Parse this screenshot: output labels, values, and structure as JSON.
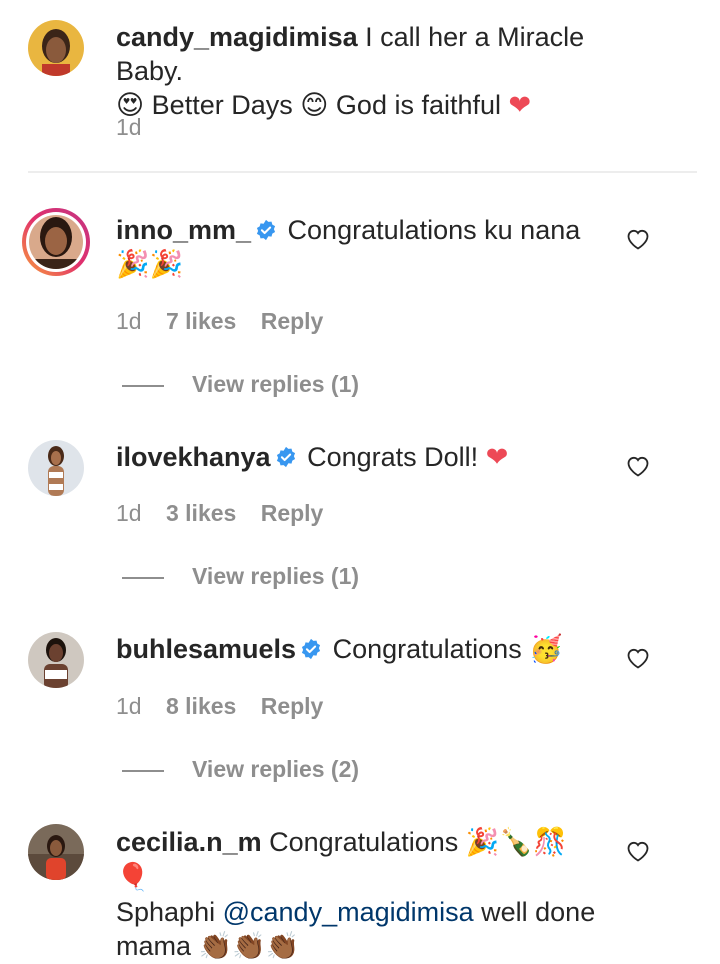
{
  "comments": [
    {
      "username": "candy_magidimisa",
      "verified": false,
      "text_line1": "I call her a Miracle Baby.",
      "text_line2_parts": [
        "😍",
        "Better Days",
        "😊",
        "God is faithful",
        "❤"
      ],
      "time": "1d",
      "likes": "",
      "reply": ""
    },
    {
      "username": "inno_mm_",
      "verified": true,
      "text": "Congratulations ku nana",
      "emoji": "🎉🎉",
      "time": "1d",
      "likes": "7 likes",
      "reply": "Reply",
      "view_replies": "View replies (1)"
    },
    {
      "username": "ilovekhanya",
      "verified": true,
      "text": "Congrats Doll!",
      "emoji": "❤",
      "time": "1d",
      "likes": "3 likes",
      "reply": "Reply",
      "view_replies": "View replies (1)"
    },
    {
      "username": "buhlesamuels",
      "verified": true,
      "text": "Congratulations",
      "emoji": "🥳",
      "time": "1d",
      "likes": "8 likes",
      "reply": "Reply",
      "view_replies": "View replies (2)"
    },
    {
      "username": "cecilia.n_m",
      "verified": false,
      "text": "Congratulations",
      "emoji": "🎉🍾🎊🎈",
      "text2": "Sphaphi",
      "mention": "@candy_magidimisa",
      "text3": "well done mama",
      "emoji2": "👏🏾👏🏾👏🏾"
    }
  ],
  "colors": {
    "text": "#262626",
    "muted": "#8e8e8e",
    "verified": "#3897f0",
    "mention": "#00376b",
    "heart_red": "#ed4956"
  }
}
